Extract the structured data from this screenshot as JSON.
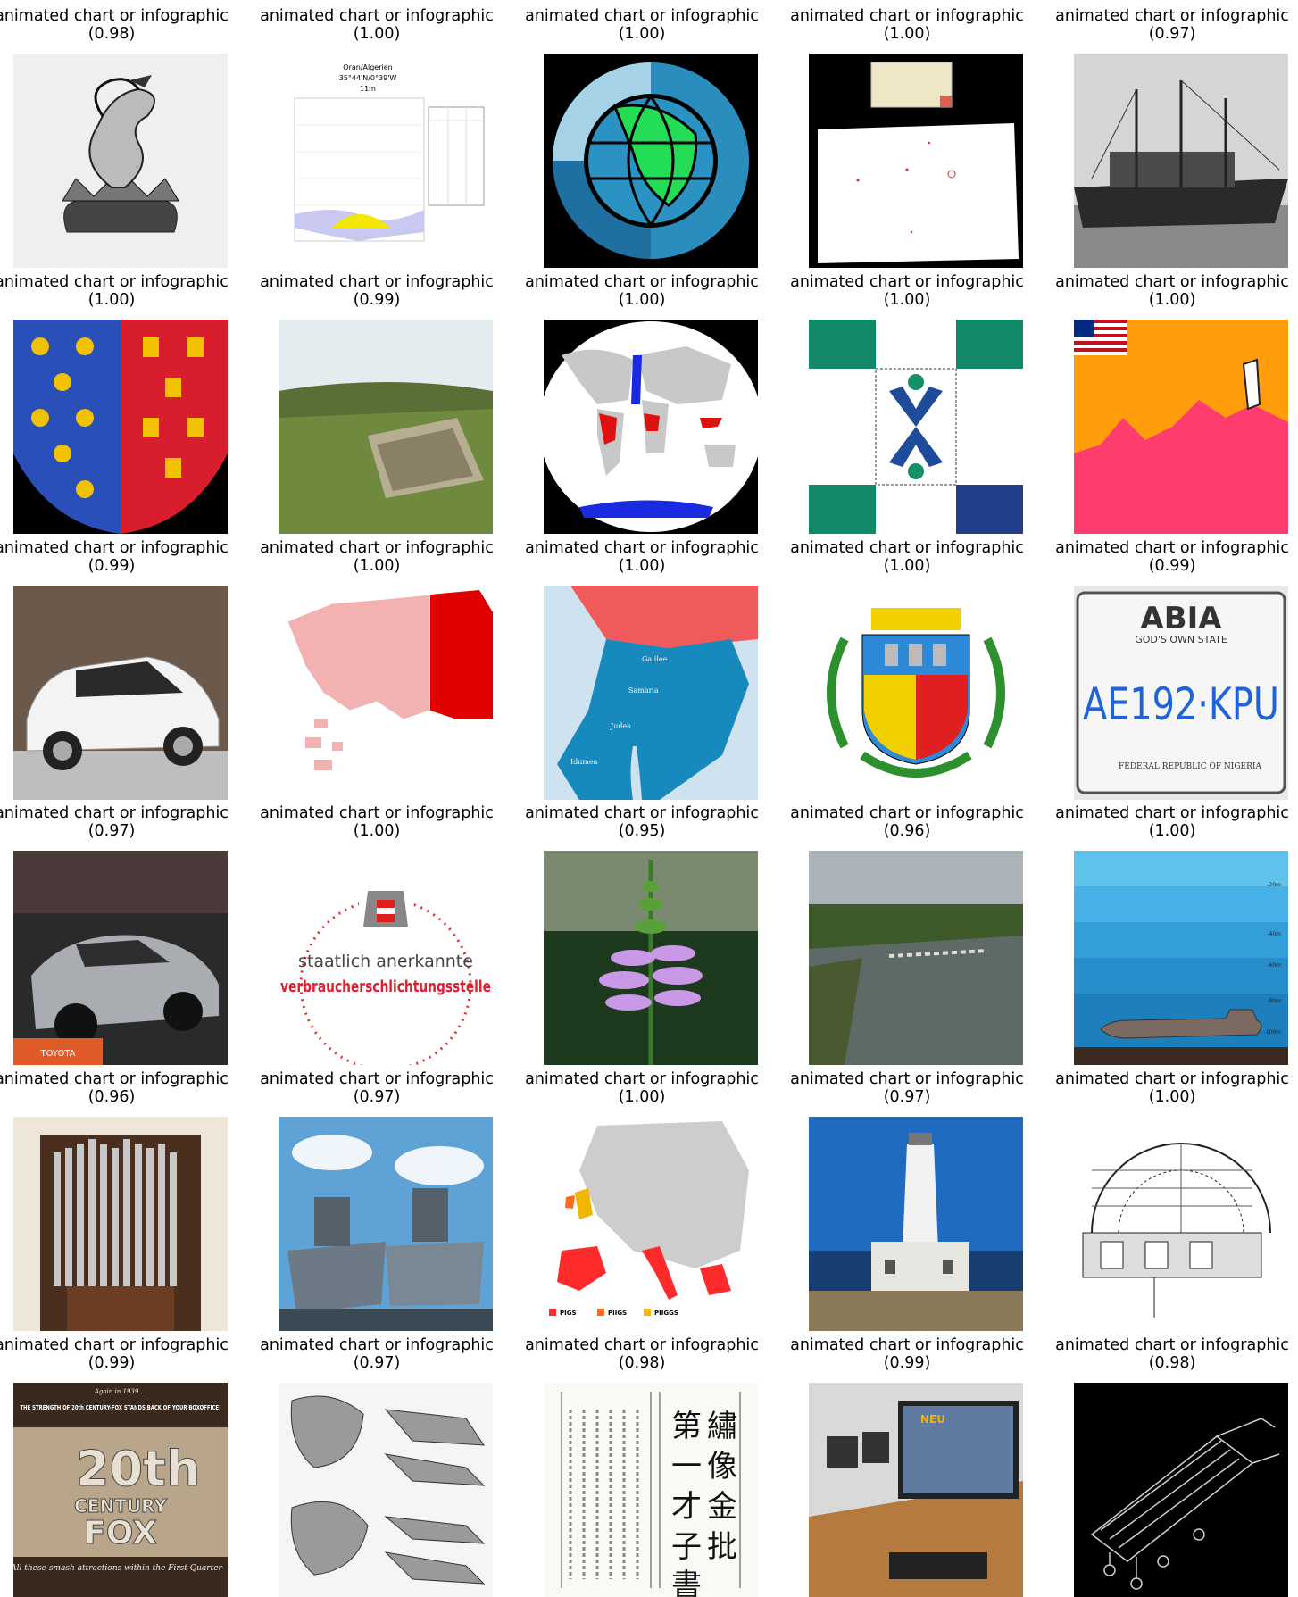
{
  "grid": {
    "cells": [
      {
        "caption": "animated chart or infographic",
        "score": "(0.98)",
        "icon": "dragon-crest-engraving"
      },
      {
        "caption": "animated chart or infographic",
        "score": "(1.00)",
        "icon": "climate-chart",
        "texts": {
          "title": "Oran/Algerien",
          "coords": "35°44'N/0°39'W",
          "elev": "11m"
        }
      },
      {
        "caption": "animated chart or infographic",
        "score": "(1.00)",
        "icon": "globe-logo"
      },
      {
        "caption": "animated chart or infographic",
        "score": "(1.00)",
        "icon": "county-locator-map"
      },
      {
        "caption": "animated chart or infographic",
        "score": "(0.97)",
        "icon": "cargo-ship-photo"
      },
      {
        "caption": "animated chart or infographic",
        "score": "(1.00)",
        "icon": "heraldic-shield"
      },
      {
        "caption": "animated chart or infographic",
        "score": "(0.99)",
        "icon": "ruins-landscape-photo"
      },
      {
        "caption": "animated chart or infographic",
        "score": "(1.00)",
        "icon": "world-distribution-map"
      },
      {
        "caption": "animated chart or infographic",
        "score": "(1.00)",
        "icon": "green-blue-flag"
      },
      {
        "caption": "animated chart or infographic",
        "score": "(1.00)",
        "icon": "orange-pink-flag"
      },
      {
        "caption": "animated chart or infographic",
        "score": "(0.99)",
        "icon": "white-suv-photo"
      },
      {
        "caption": "animated chart or infographic",
        "score": "(1.00)",
        "icon": "pink-red-region-map"
      },
      {
        "caption": "animated chart or infographic",
        "score": "(1.00)",
        "icon": "ancient-israel-map",
        "texts": {
          "l1": "Galilee",
          "l2": "Samaria",
          "l3": "Judea",
          "l4": "Idumea"
        }
      },
      {
        "caption": "animated chart or infographic",
        "score": "(1.00)",
        "icon": "municipal-coat-of-arms"
      },
      {
        "caption": "animated chart or infographic",
        "score": "(0.99)",
        "icon": "license-plate",
        "texts": {
          "state": "ABIA",
          "slogan": "GOD'S OWN STATE",
          "plate": "AE192·KPU",
          "footer": "FEDERAL REPUBLIC OF NIGERIA"
        }
      },
      {
        "caption": "animated chart or infographic",
        "score": "(0.97)",
        "icon": "silver-sports-car-photo",
        "texts": {
          "brand": "TOYOTA"
        }
      },
      {
        "caption": "animated chart or infographic",
        "score": "(1.00)",
        "icon": "austrian-eagle-seal",
        "texts": {
          "line1": "staatlich anerkannte",
          "line2": "verbraucherschlichtungsstelle"
        }
      },
      {
        "caption": "animated chart or infographic",
        "score": "(0.95)",
        "icon": "pink-flower-photo"
      },
      {
        "caption": "animated chart or infographic",
        "score": "(0.96)",
        "icon": "river-photo"
      },
      {
        "caption": "animated chart or infographic",
        "score": "(1.00)",
        "icon": "submarine-depth-chart",
        "texts": {
          "d1": "-20m",
          "d2": "-40m",
          "d3": "-60m",
          "d4": "-80m",
          "d5": "-100m"
        }
      },
      {
        "caption": "animated chart or infographic",
        "score": "(0.96)",
        "icon": "pipe-organ-photo"
      },
      {
        "caption": "animated chart or infographic",
        "score": "(0.97)",
        "icon": "warships-photo"
      },
      {
        "caption": "animated chart or infographic",
        "score": "(1.00)",
        "icon": "europe-piigs-map",
        "texts": {
          "k1": "PIGS",
          "k2": "PIIGS",
          "k3": "PIIGGS"
        }
      },
      {
        "caption": "animated chart or infographic",
        "score": "(0.97)",
        "icon": "lighthouse-photo"
      },
      {
        "caption": "animated chart or infographic",
        "score": "(1.00)",
        "icon": "technical-drawing"
      },
      {
        "caption": "animated chart or infographic",
        "score": "(0.99)",
        "icon": "20th-century-fox-poster",
        "texts": {
          "top": "Again in 1939 ...",
          "head": "THE STRENGTH OF 20th CENTURY-FOX STANDS BACK OF YOUR BOXOFFICE!",
          "logo1": "20th",
          "logo2": "CENTURY",
          "logo3": "FOX",
          "foot": "All these smash attractions within the First Quarter—"
        }
      },
      {
        "caption": "animated chart or infographic",
        "score": "(0.97)",
        "icon": "fossil-skulls-plate"
      },
      {
        "caption": "animated chart or infographic",
        "score": "(0.98)",
        "icon": "chinese-book-page",
        "texts": {
          "t1": "第",
          "t2": "一",
          "t3": "才",
          "t4": "子",
          "t5": "書",
          "t6": "繡",
          "t7": "像",
          "t8": "金",
          "t9": "批"
        }
      },
      {
        "caption": "animated chart or infographic",
        "score": "(0.99)",
        "icon": "computer-lab-photo",
        "texts": {
          "screen": "NEU"
        }
      },
      {
        "caption": "animated chart or infographic",
        "score": "(0.98)",
        "icon": "wireframe-machine-render"
      }
    ]
  }
}
